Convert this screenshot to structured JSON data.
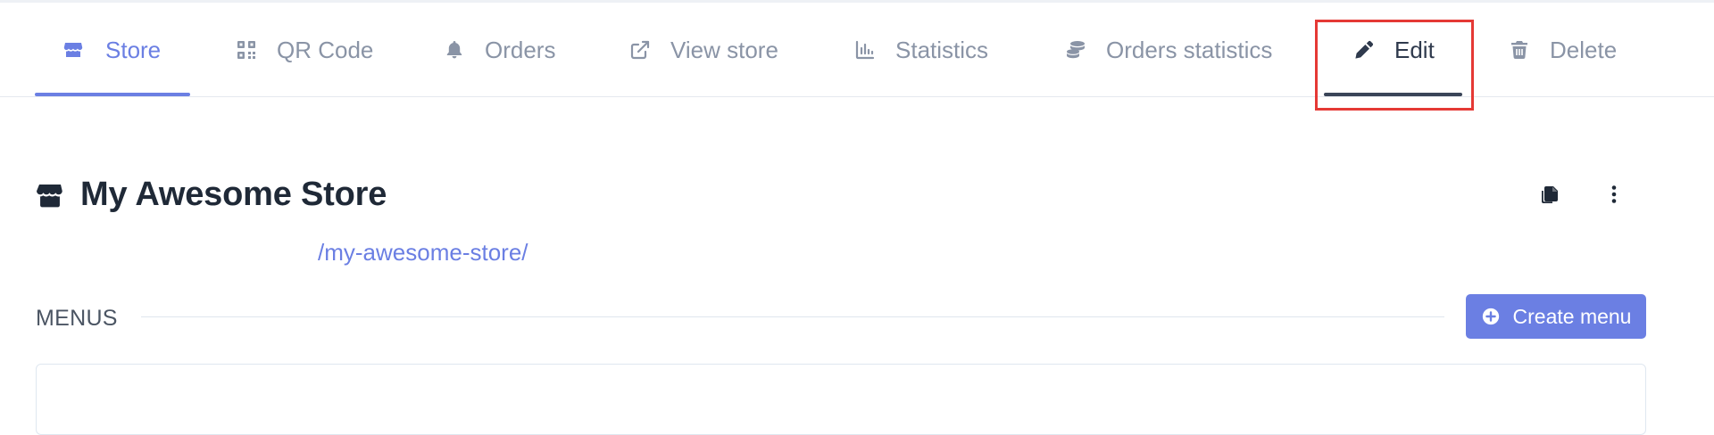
{
  "tabs": [
    {
      "label": "Store",
      "icon": "store-icon",
      "active": true
    },
    {
      "label": "QR Code",
      "icon": "qr-code-icon"
    },
    {
      "label": "Orders",
      "icon": "bell-icon"
    },
    {
      "label": "View store",
      "icon": "external-link-icon"
    },
    {
      "label": "Statistics",
      "icon": "chart-icon"
    },
    {
      "label": "Orders statistics",
      "icon": "coins-icon"
    },
    {
      "label": "Edit",
      "icon": "pencil-icon",
      "highlighted": true
    },
    {
      "label": "Delete",
      "icon": "trash-icon"
    }
  ],
  "store": {
    "title": "My Awesome Store",
    "slug": "/my-awesome-store/"
  },
  "menus": {
    "label": "MENUS",
    "create_label": "Create menu"
  },
  "colors": {
    "accent": "#6b7fe3",
    "muted_text": "#8a94a6",
    "highlight_box": "#e53935"
  }
}
